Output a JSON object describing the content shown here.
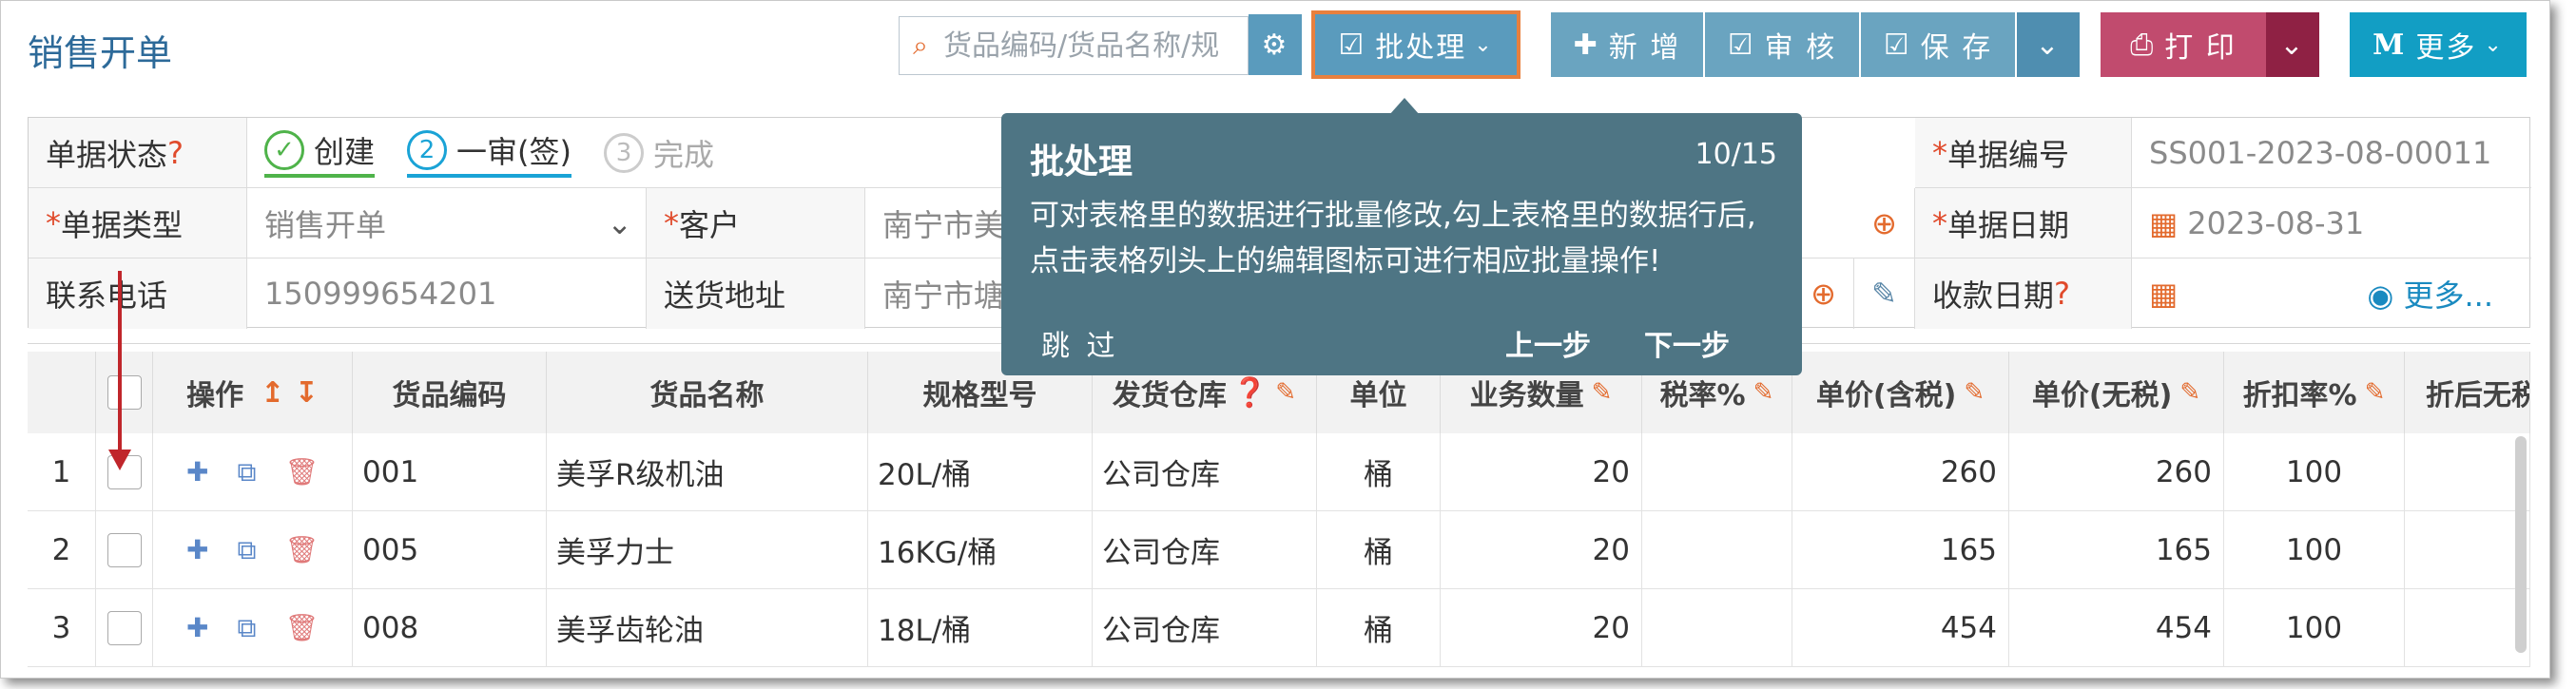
{
  "header": {
    "title": "销售开单",
    "search_placeholder": "货品编码/货品名称/规",
    "batch_label": "批处理",
    "add_label": "新 增",
    "audit_label": "审 核",
    "save_label": "保 存",
    "print_label": "打 印",
    "more_label": "更多"
  },
  "form": {
    "status_label": "单据状态",
    "steps": [
      {
        "num": "✓",
        "label": "创建"
      },
      {
        "num": "2",
        "label": "一审(签)"
      },
      {
        "num": "3",
        "label": "完成"
      }
    ],
    "doc_type_label": "单据类型",
    "doc_type_value": "销售开单",
    "customer_label": "客户",
    "customer_value": "南宁市美",
    "phone_label": "联系电话",
    "phone_value": "150999654201",
    "address_label": "送货地址",
    "address_value": "南宁市塘",
    "doc_no_label": "单据编号",
    "doc_no_value": "SS001-2023-08-00011",
    "doc_date_label": "单据日期",
    "doc_date_value": "2023-08-31",
    "pay_date_label": "收款日期",
    "more_link": "更多..."
  },
  "table": {
    "headers": {
      "ops": "操作",
      "code": "货品编码",
      "name": "货品名称",
      "spec": "规格型号",
      "warehouse": "发货仓库",
      "unit": "单位",
      "qty": "业务数量",
      "tax_rate": "税率%",
      "price_tax": "单价(含税)",
      "price_notax": "单价(无税)",
      "discount": "折扣率%",
      "after": "折后无税单"
    },
    "rows": [
      {
        "idx": "1",
        "code": "001",
        "name": "美孚R级机油",
        "spec": "20L/桶",
        "warehouse": "公司仓库",
        "unit": "桶",
        "qty": "20",
        "tax_rate": "",
        "price_tax": "260",
        "price_notax": "260",
        "discount": "100"
      },
      {
        "idx": "2",
        "code": "005",
        "name": "美孚力士",
        "spec": "16KG/桶",
        "warehouse": "公司仓库",
        "unit": "桶",
        "qty": "20",
        "tax_rate": "",
        "price_tax": "165",
        "price_notax": "165",
        "discount": "100"
      },
      {
        "idx": "3",
        "code": "008",
        "name": "美孚齿轮油",
        "spec": "18L/桶",
        "warehouse": "公司仓库",
        "unit": "桶",
        "qty": "20",
        "tax_rate": "",
        "price_tax": "454",
        "price_notax": "454",
        "discount": "100"
      }
    ]
  },
  "tooltip": {
    "title": "批处理",
    "counter": "10/15",
    "body": "可对表格里的数据进行批量修改,勾上表格里的数据行后,点击表格列头上的编辑图标可进行相应批量操作!",
    "skip": "跳 过",
    "prev": "上一步",
    "next": "下一步"
  },
  "colors": {
    "brand_blue": "#5a9bbd",
    "print_red": "#c14b6e",
    "more_cyan": "#129ec4",
    "tooltip_bg": "#4e7584",
    "accent_orange": "#e8803e"
  }
}
